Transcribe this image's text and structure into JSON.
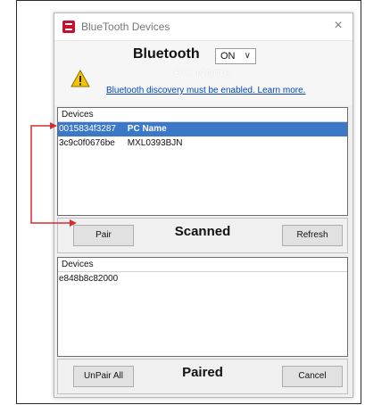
{
  "window": {
    "title": "BlueTooth Devices",
    "close_glyph": "×"
  },
  "bluetooth": {
    "label": "Bluetooth",
    "state": "ON",
    "ghost_text": "PC Name",
    "warning": "Bluetooth discovery must be enabled. Learn more."
  },
  "scanned": {
    "header": "Devices",
    "items": [
      {
        "address": "0015834f3287",
        "name": "PC Name",
        "selected": true
      },
      {
        "address": "3c9c0f0676be",
        "name": "MXL0393BJN",
        "selected": false
      }
    ],
    "pair_label": "Pair",
    "section_label": "Scanned",
    "refresh_label": "Refresh"
  },
  "paired": {
    "header": "Devices",
    "items": [
      {
        "address": "e848b8c82000",
        "name": ""
      }
    ],
    "unpair_label": "UnPair All",
    "section_label": "Paired",
    "cancel_label": "Cancel"
  },
  "colors": {
    "selection": "#3b78c8",
    "annotation_arrow": "#d32f2f",
    "link": "#0645ad"
  }
}
